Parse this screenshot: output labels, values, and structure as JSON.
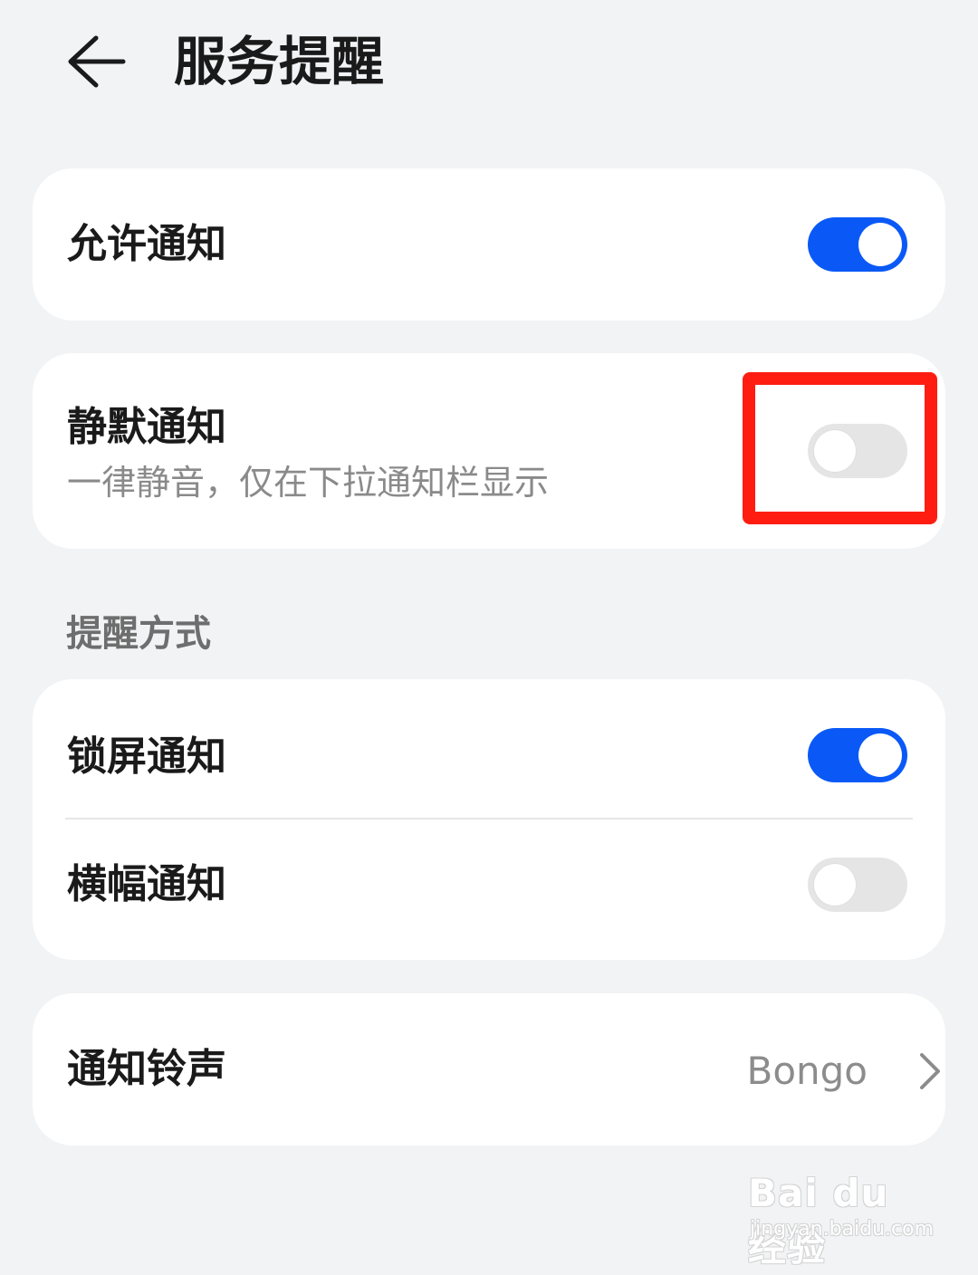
{
  "header": {
    "title": "服务提醒",
    "back_icon": "back-arrow-icon"
  },
  "allow_notifications": {
    "label": "允许通知",
    "enabled": true
  },
  "silent_notifications": {
    "label": "静默通知",
    "description": "一律静音，仅在下拉通知栏显示",
    "enabled": false
  },
  "reminder_section": {
    "header": "提醒方式",
    "items": [
      {
        "label": "锁屏通知",
        "enabled": true
      },
      {
        "label": "横幅通知",
        "enabled": false
      }
    ]
  },
  "ringtone": {
    "label": "通知铃声",
    "value": "Bongo",
    "chevron_icon": "chevron-right-icon"
  },
  "watermark": {
    "logo": "Bai du 经验",
    "url": "jingyan.baidu.com"
  },
  "colors": {
    "accent": "#0a59f7",
    "highlight": "#ff1d12",
    "background": "#f1f3f5"
  }
}
